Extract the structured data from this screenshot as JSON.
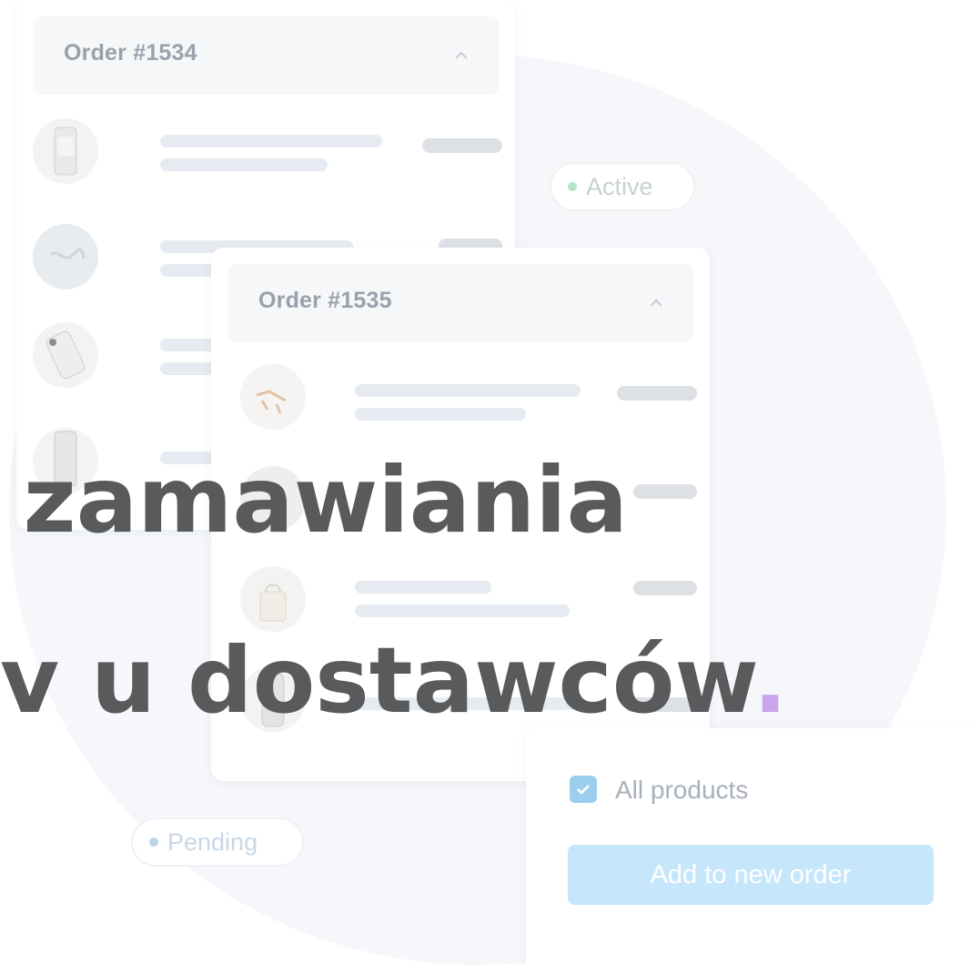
{
  "orders": [
    {
      "title": "Order #1534",
      "status": "Active"
    },
    {
      "title": "Order #1535",
      "status": "Pending"
    }
  ],
  "panel": {
    "checkbox_label": "All products",
    "checked": true,
    "button_label": "Add to new order"
  },
  "headline": {
    "line1": "zamawiania",
    "line2": "v u dostawców",
    "accent_char": "."
  },
  "colors": {
    "headline": "#595a5c",
    "accent": "#c8a6ec",
    "button": "#c6e6fb",
    "active_dot": "#b7e3c8",
    "pending_dot": "#b7d6ec"
  }
}
